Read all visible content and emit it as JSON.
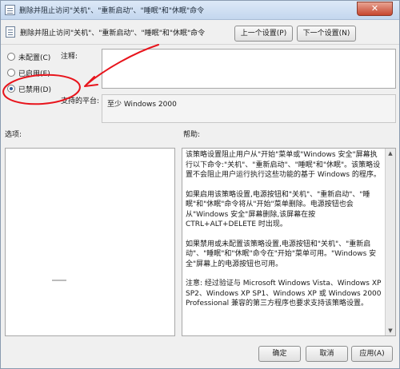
{
  "window": {
    "title": "删除并阻止访问\"关机\"、\"重新启动\"、\"睡眠\"和\"休眠\"命令",
    "close_glyph": "✕"
  },
  "header": {
    "policy_name": "删除并阻止访问\"关机\"、\"重新启动\"、\"睡眠\"和\"休眠\"命令",
    "prev_button": "上一个设置(P)",
    "next_button": "下一个设置(N)"
  },
  "settings": {
    "not_configured": "未配置(C)",
    "enabled": "已启用(E)",
    "disabled": "已禁用(D)",
    "selected": "disabled"
  },
  "comment": {
    "label": "注释:",
    "value": ""
  },
  "supported": {
    "label": "支持的平台:",
    "value": "至少 Windows 2000"
  },
  "options": {
    "label": "选项:"
  },
  "help": {
    "label": "帮助:",
    "paragraphs": [
      "该策略设置阻止用户从\"开始\"菜单或\"Windows 安全\"屏幕执行以下命令:\"关机\"、\"重新启动\"、\"睡眠\"和\"休眠\"。该策略设置不会阻止用户运行执行这些功能的基于 Windows 的程序。",
      "如果启用该策略设置,电源按钮和\"关机\"、\"重新启动\"、\"睡眠\"和\"休眠\"命令将从\"开始\"菜单删除。电源按钮也会从\"Windows 安全\"屏幕删除,该屏幕在按 CTRL+ALT+DELETE 时出现。",
      "如果禁用或未配置该策略设置,电源按钮和\"关机\"、\"重新启动\"、\"睡眠\"和\"休眠\"命令在\"开始\"菜单可用。\"Windows 安全\"屏幕上的电源按钮也可用。",
      "注意: 经过验证与 Microsoft Windows Vista、Windows XP SP2、Windows XP SP1、Windows XP 或 Windows 2000 Professional 兼容的第三方程序也要求支持该策略设置。"
    ]
  },
  "footer": {
    "ok_button": "确定",
    "cancel_button": "取消",
    "apply_button": "应用(A)"
  },
  "annotation": {
    "color": "#e8141c"
  }
}
